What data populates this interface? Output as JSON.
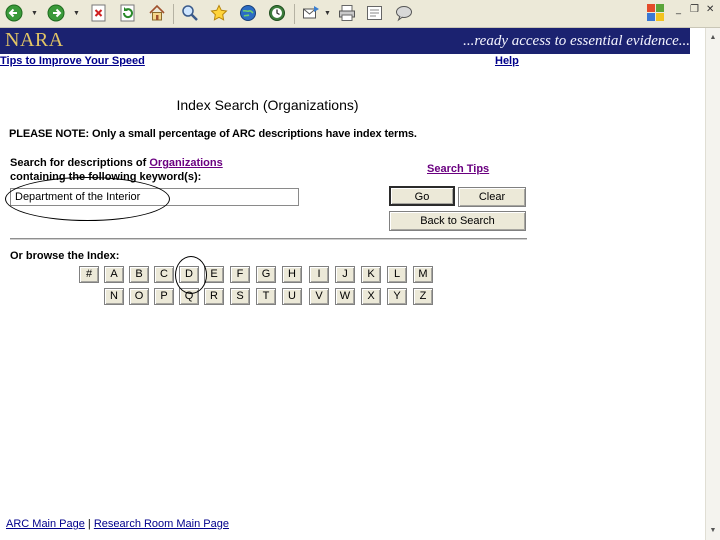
{
  "toolbar": {
    "buttons": [
      "back-icon",
      "forward-icon",
      "stop-icon",
      "refresh-icon",
      "home-icon",
      "search-icon",
      "favorites-icon",
      "media-icon",
      "history-icon",
      "mail-icon",
      "print-icon",
      "edit-icon",
      "discuss-icon"
    ],
    "window_controls": {
      "minimize": "_",
      "restore": "❐",
      "close": "✕"
    }
  },
  "banner": {
    "logo": "NARA",
    "tagline": "...ready access to essential evidence..."
  },
  "top_links": {
    "left": "Tips to Improve Your Speed",
    "right": "Help"
  },
  "page": {
    "title": "Index Search (Organizations)",
    "note": "PLEASE NOTE: Only a small percentage of ARC descriptions have index terms."
  },
  "search": {
    "label_prefix": "Search for descriptions of ",
    "label_link": "Organizations",
    "label_suffix": "containing the following keyword(s):",
    "keyword_value": "Department of the Interior",
    "tips_link": "Search Tips",
    "go_label": "Go",
    "clear_label": "Clear",
    "back_label": "Back to Search"
  },
  "browse": {
    "label": "Or browse the Index:",
    "row1": [
      "#",
      "A",
      "B",
      "C",
      "D",
      "E",
      "F",
      "G",
      "H",
      "I",
      "J",
      "K",
      "L",
      "M"
    ],
    "row2": [
      "N",
      "O",
      "P",
      "Q",
      "R",
      "S",
      "T",
      "U",
      "V",
      "W",
      "X",
      "Y",
      "Z"
    ]
  },
  "footer": {
    "link1": "ARC Main Page",
    "separator": " | ",
    "link2": "Research Room Main Page"
  },
  "colors": {
    "banner_bg": "#1b2270",
    "logo": "#e2c565",
    "link": "#00008b",
    "visited_link": "#6a0080",
    "button_face": "#ece9d8"
  }
}
